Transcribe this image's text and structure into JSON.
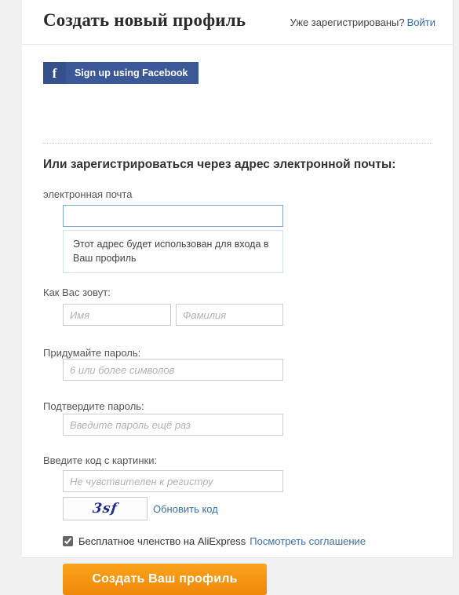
{
  "header": {
    "title": "Создать новый профиль",
    "already_registered_text": "Уже зарегистрированы?",
    "signin_label": "Войти"
  },
  "social": {
    "facebook_icon": "facebook-f-icon",
    "facebook_label": "Sign up using Facebook"
  },
  "form": {
    "section_title": "Или зарегистрироваться через адрес электронной почты:",
    "email": {
      "label": "электронная почта",
      "value": "",
      "placeholder": "",
      "hint": "Этот адрес будет использован для входа в Ваш профиль"
    },
    "name": {
      "label": "Как Вас зовут:",
      "first_placeholder": "Имя",
      "first_value": "",
      "last_placeholder": "Фамилия",
      "last_value": ""
    },
    "password": {
      "label": "Придумайте пароль:",
      "placeholder": "6 или более символов",
      "value": ""
    },
    "confirm": {
      "label": "Подтвердите пароль:",
      "placeholder": "Введите пароль ещё раз",
      "value": ""
    },
    "captcha": {
      "label": "Введите код с картинки:",
      "placeholder": "Не чувствителен к регистру",
      "value": "",
      "code_image_text": "3sf",
      "refresh_label": "Обновить код"
    },
    "agreement": {
      "checked": true,
      "text": "Бесплатное членство на AliExpress",
      "link_label": "Посмотреть соглашение"
    },
    "submit_label": "Создать Ваш профиль"
  },
  "colors": {
    "facebook_blue": "#3b5998",
    "submit_orange": "#f59312",
    "link_blue": "#3d6fa8",
    "focus_border": "#7ba7d0",
    "page_background": "#f1f1f1"
  }
}
